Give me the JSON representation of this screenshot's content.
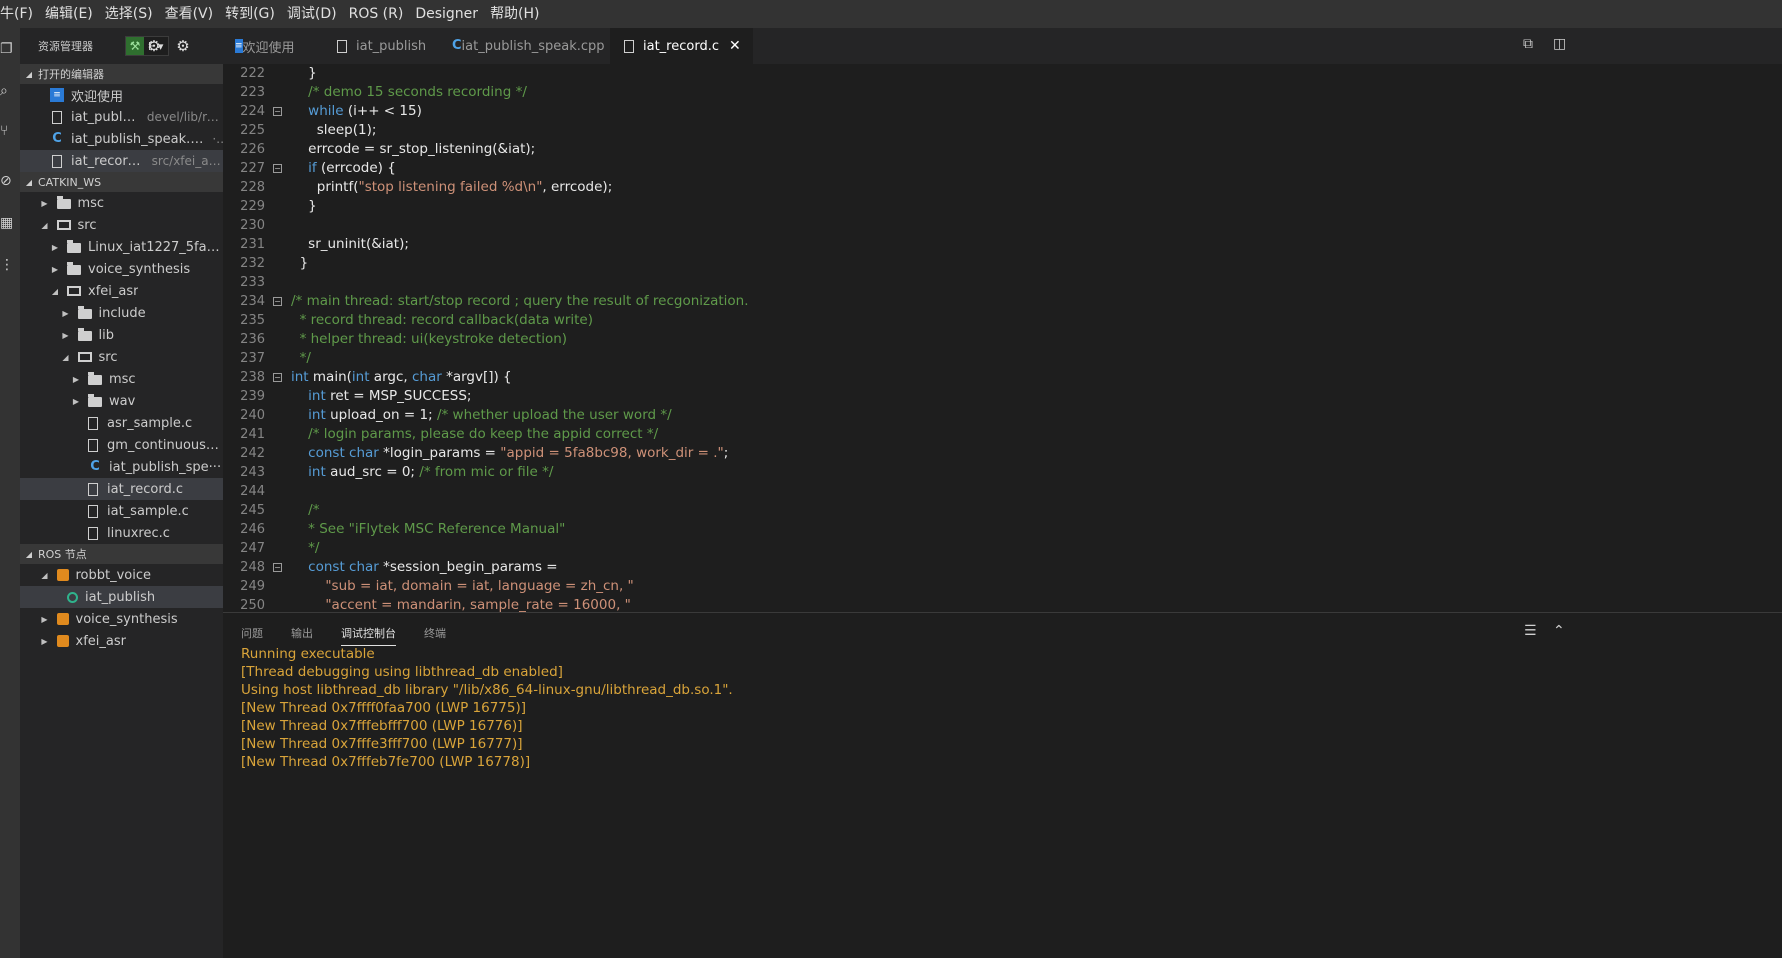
{
  "menu": [
    "牛(F)",
    "编辑(E)",
    "选择(S)",
    "查看(V)",
    "转到(G)",
    "调试(D)",
    "ROS (R)",
    "Designer",
    "帮助(H)"
  ],
  "activity_icons": [
    "explorer-icon",
    "search-icon",
    "source-control-icon",
    "debug-icon",
    "extensions-icon",
    "more-icon"
  ],
  "sidebar": {
    "title": "资源管理器",
    "picker_label": "F ▾",
    "open_editors": {
      "title": "打开的编辑器",
      "items": [
        {
          "label": "欢迎使用",
          "sub": "",
          "icon": "welcome"
        },
        {
          "label": "iat_publish",
          "sub": "devel/lib/ro···",
          "icon": "file"
        },
        {
          "label": "iat_publish_speak.cpp",
          "sub": "···",
          "icon": "cpp"
        },
        {
          "label": "iat_record.c",
          "sub": "src/xfei_as···",
          "icon": "file"
        }
      ]
    },
    "workspace": {
      "title": "CATKIN_WS",
      "items": [
        {
          "label": "msc",
          "type": "folder",
          "twisty": "closed"
        },
        {
          "label": "src",
          "type": "folder-open",
          "twisty": "open"
        },
        {
          "label": "Linux_iat1227_5fa8bb···",
          "type": "folder",
          "twisty": "closed"
        },
        {
          "label": "voice_synthesis",
          "type": "folder",
          "twisty": "closed"
        },
        {
          "label": "xfei_asr",
          "type": "folder-open",
          "twisty": "open"
        },
        {
          "label": "include",
          "type": "folder",
          "twisty": "closed"
        },
        {
          "label": "lib",
          "type": "folder",
          "twisty": "closed"
        },
        {
          "label": "src",
          "type": "folder-open",
          "twisty": "open"
        },
        {
          "label": "msc",
          "type": "folder",
          "twisty": "closed"
        },
        {
          "label": "wav",
          "type": "folder",
          "twisty": "closed"
        },
        {
          "label": "asr_sample.c",
          "type": "file",
          "twisty": ""
        },
        {
          "label": "gm_continuous_···",
          "type": "file",
          "twisty": ""
        },
        {
          "label": "iat_publish_spe···",
          "type": "cpp",
          "twisty": ""
        },
        {
          "label": "iat_record.c",
          "type": "file",
          "twisty": ""
        },
        {
          "label": "iat_sample.c",
          "type": "file",
          "twisty": ""
        },
        {
          "label": "linuxrec.c",
          "type": "file",
          "twisty": ""
        }
      ]
    },
    "ros": {
      "title": "ROS 节点",
      "items": [
        {
          "label": "robbt_voice",
          "type": "pkg",
          "twisty": "open"
        },
        {
          "label": "iat_publish",
          "type": "node",
          "twisty": ""
        },
        {
          "label": "voice_synthesis",
          "type": "pkg",
          "twisty": "closed"
        },
        {
          "label": "xfei_asr",
          "type": "pkg",
          "twisty": "closed"
        }
      ]
    }
  },
  "tabs": [
    {
      "label": "欢迎使用",
      "icon": "welcome"
    },
    {
      "label": "iat_publish",
      "icon": "file"
    },
    {
      "label": "iat_publish_speak.cpp",
      "icon": "cpp"
    },
    {
      "label": "iat_record.c",
      "icon": "file",
      "active": true,
      "close": "✕"
    }
  ],
  "editor": {
    "lines": [
      {
        "n": "222",
        "fold": false,
        "segs": [
          [
            "    }",
            ""
          ]
        ]
      },
      {
        "n": "223",
        "fold": false,
        "segs": [
          [
            "    /* demo 15 seconds recording */",
            "cm"
          ]
        ]
      },
      {
        "n": "224",
        "fold": true,
        "segs": [
          [
            "    ",
            ""
          ],
          [
            "while",
            "kw"
          ],
          [
            " (i++ < 15)",
            ""
          ]
        ]
      },
      {
        "n": "225",
        "fold": false,
        "segs": [
          [
            "      sleep(1);",
            ""
          ]
        ]
      },
      {
        "n": "226",
        "fold": false,
        "segs": [
          [
            "    errcode = sr_stop_listening(&iat);",
            ""
          ]
        ]
      },
      {
        "n": "227",
        "fold": true,
        "segs": [
          [
            "    ",
            ""
          ],
          [
            "if",
            "kw"
          ],
          [
            " (errcode) {",
            ""
          ]
        ]
      },
      {
        "n": "228",
        "fold": false,
        "segs": [
          [
            "      printf(",
            ""
          ],
          [
            "\"stop listening failed %d\\n\"",
            "st"
          ],
          [
            ", errcode);",
            ""
          ]
        ]
      },
      {
        "n": "229",
        "fold": false,
        "segs": [
          [
            "    }",
            ""
          ]
        ]
      },
      {
        "n": "230",
        "fold": false,
        "segs": [
          [
            "",
            ""
          ]
        ]
      },
      {
        "n": "231",
        "fold": false,
        "segs": [
          [
            "    sr_uninit(&iat);",
            ""
          ]
        ]
      },
      {
        "n": "232",
        "fold": false,
        "segs": [
          [
            "  }",
            ""
          ]
        ]
      },
      {
        "n": "233",
        "fold": false,
        "segs": [
          [
            "",
            ""
          ]
        ]
      },
      {
        "n": "234",
        "fold": true,
        "segs": [
          [
            "/* main thread: start/stop record ; query the result of recgonization.",
            "cm"
          ]
        ]
      },
      {
        "n": "235",
        "fold": false,
        "segs": [
          [
            "  * record thread: record callback(data write)",
            "cm"
          ]
        ]
      },
      {
        "n": "236",
        "fold": false,
        "segs": [
          [
            "  * helper thread: ui(keystroke detection)",
            "cm"
          ]
        ]
      },
      {
        "n": "237",
        "fold": false,
        "segs": [
          [
            "  */",
            "cm"
          ]
        ]
      },
      {
        "n": "238",
        "fold": true,
        "segs": [
          [
            "int",
            "kw"
          ],
          [
            " main(",
            ""
          ],
          [
            "int",
            "kw"
          ],
          [
            " argc, ",
            ""
          ],
          [
            "char",
            "kw"
          ],
          [
            " *argv[]) {",
            ""
          ]
        ]
      },
      {
        "n": "239",
        "fold": false,
        "segs": [
          [
            "    ",
            ""
          ],
          [
            "int",
            "kw"
          ],
          [
            " ret = MSP_SUCCESS;",
            ""
          ]
        ]
      },
      {
        "n": "240",
        "fold": false,
        "segs": [
          [
            "    ",
            ""
          ],
          [
            "int",
            "kw"
          ],
          [
            " upload_on = 1; ",
            ""
          ],
          [
            "/* whether upload the user word */",
            "cm"
          ]
        ]
      },
      {
        "n": "241",
        "fold": false,
        "segs": [
          [
            "    /* login params, please do keep the appid correct */",
            "cm"
          ]
        ]
      },
      {
        "n": "242",
        "fold": false,
        "segs": [
          [
            "    ",
            ""
          ],
          [
            "const",
            "kw"
          ],
          [
            " ",
            ""
          ],
          [
            "char",
            "kw"
          ],
          [
            " *login_params = ",
            ""
          ],
          [
            "\"appid = 5fa8bc98, work_dir = .\"",
            "st"
          ],
          [
            ";",
            ""
          ]
        ]
      },
      {
        "n": "243",
        "fold": false,
        "segs": [
          [
            "    ",
            ""
          ],
          [
            "int",
            "kw"
          ],
          [
            " aud_src = 0; ",
            ""
          ],
          [
            "/* from mic or file */",
            "cm"
          ]
        ]
      },
      {
        "n": "244",
        "fold": false,
        "segs": [
          [
            "",
            ""
          ]
        ]
      },
      {
        "n": "245",
        "fold": false,
        "segs": [
          [
            "    /*",
            "cm"
          ]
        ]
      },
      {
        "n": "246",
        "fold": false,
        "segs": [
          [
            "    * See \"iFlytek MSC Reference Manual\"",
            "cm"
          ]
        ]
      },
      {
        "n": "247",
        "fold": false,
        "segs": [
          [
            "    */",
            "cm"
          ]
        ]
      },
      {
        "n": "248",
        "fold": true,
        "segs": [
          [
            "    ",
            ""
          ],
          [
            "const",
            "kw"
          ],
          [
            " ",
            ""
          ],
          [
            "char",
            "kw"
          ],
          [
            " *session_begin_params =",
            ""
          ]
        ]
      },
      {
        "n": "249",
        "fold": false,
        "segs": [
          [
            "        ",
            ""
          ],
          [
            "\"sub = iat, domain = iat, language = zh_cn, \"",
            "st"
          ]
        ]
      },
      {
        "n": "250",
        "fold": false,
        "segs": [
          [
            "        ",
            ""
          ],
          [
            "\"accent = mandarin, sample_rate = 16000, \"",
            "st"
          ]
        ]
      }
    ]
  },
  "panel": {
    "tabs": [
      "问题",
      "输出",
      "调试控制台",
      "终端"
    ],
    "active_tab": "调试控制台",
    "output": [
      "Running executable",
      "[Thread debugging using libthread_db enabled]",
      "Using host libthread_db library \"/lib/x86_64-linux-gnu/libthread_db.so.1\".",
      "[New Thread 0x7ffff0faa700 (LWP 16775)]",
      "[New Thread 0x7fffebfff700 (LWP 16776)]",
      "[New Thread 0x7fffe3fff700 (LWP 16777)]",
      "[New Thread 0x7fffeb7fe700 (LWP 16778)]"
    ]
  },
  "colors": {
    "background": "#1e1e1e",
    "sidebar": "#252526",
    "comment": "#5f9a4a",
    "keyword": "#569cd6",
    "string": "#ce9178",
    "console_output": "#d9a43a"
  }
}
